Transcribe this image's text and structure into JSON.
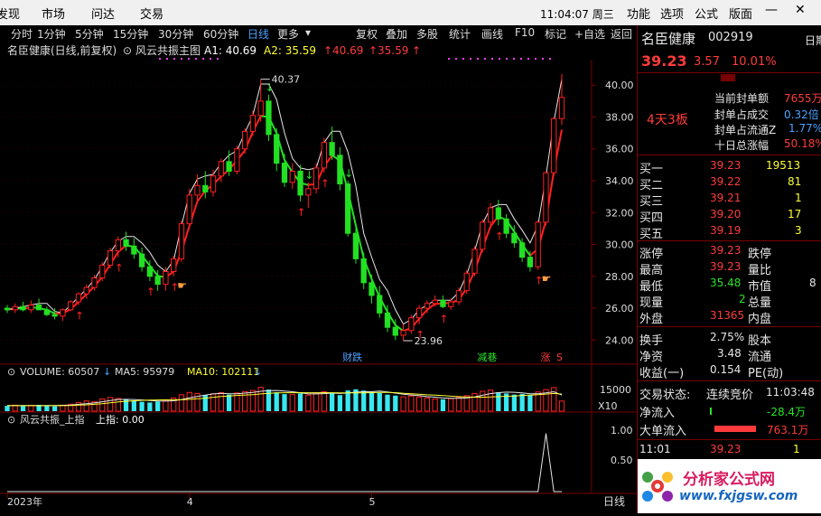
{
  "menu": {
    "items": [
      "发现",
      "市场",
      "问达",
      "交易"
    ],
    "time": "11:04:07 周三",
    "right_items": [
      "功能",
      "选项",
      "公式",
      "版面"
    ]
  },
  "toolbar": {
    "periods": [
      "分时",
      "1分钟",
      "5分钟",
      "15分钟",
      "30分钟",
      "60分钟",
      "日线",
      "更多"
    ],
    "active": "日线",
    "tools": [
      "复权",
      "叠加",
      "多股",
      "统计",
      "画线",
      "F10",
      "标记",
      "+自选",
      "返回"
    ]
  },
  "main_header": {
    "name": "名臣健康(日线,前复权)",
    "indicator": "风云共振主图",
    "a1_label": "A1: 40.69",
    "a2_label": "A2: 35.59",
    "v1": "40.69",
    "v2": "35.59"
  },
  "volume_header": {
    "vol": "VOLUME: 60507",
    "ma5": "MA5: 95979",
    "ma10": "MA10: 102111"
  },
  "sub_header": {
    "name": "风云共振_上指",
    "val": "上指: 0.00"
  },
  "chart_data": [
    {
      "type": "candlestick",
      "ylim": [
        22.6,
        41.6
      ],
      "y_ticks": [
        "40.00",
        "38.00",
        "36.00",
        "34.00",
        "32.00",
        "30.00",
        "28.00",
        "26.00",
        "24.00"
      ],
      "x_ticks": [
        {
          "label": "2023年",
          "index": 0
        },
        {
          "label": "4",
          "index": 23
        },
        {
          "label": "5",
          "index": 46
        }
      ],
      "annotations": [
        {
          "text": "40.37",
          "index": 32,
          "value": 40.37
        },
        {
          "text": "23.96",
          "index": 50,
          "value": 23.96
        },
        {
          "text": "财跌",
          "index": 43
        },
        {
          "text": "减巷",
          "index": 60
        },
        {
          "text": "涨",
          "index": 68
        },
        {
          "text": "S",
          "index": 70
        }
      ],
      "candles": [
        [
          26.0,
          26.2,
          25.7,
          25.9
        ],
        [
          25.9,
          26.3,
          25.7,
          26.1
        ],
        [
          26.1,
          26.4,
          25.8,
          25.9
        ],
        [
          25.9,
          26.5,
          25.7,
          26.2
        ],
        [
          26.2,
          26.6,
          25.9,
          25.9
        ],
        [
          25.9,
          26.1,
          25.5,
          25.6
        ],
        [
          25.6,
          26.0,
          25.3,
          25.5
        ],
        [
          25.5,
          26.0,
          25.2,
          25.9
        ],
        [
          25.9,
          26.5,
          25.8,
          26.4
        ],
        [
          26.4,
          27.0,
          26.2,
          26.9
        ],
        [
          26.9,
          27.5,
          26.6,
          27.3
        ],
        [
          27.3,
          28.1,
          27.1,
          27.9
        ],
        [
          27.9,
          28.9,
          27.7,
          28.7
        ],
        [
          28.7,
          29.8,
          28.5,
          29.6
        ],
        [
          29.6,
          30.5,
          29.2,
          30.3
        ],
        [
          30.3,
          30.8,
          29.6,
          29.9
        ],
        [
          29.9,
          30.4,
          29.1,
          29.4
        ],
        [
          29.4,
          29.8,
          28.3,
          28.6
        ],
        [
          28.6,
          29.0,
          27.7,
          28.0
        ],
        [
          28.0,
          28.4,
          27.1,
          27.5
        ],
        [
          27.5,
          28.6,
          27.1,
          28.3
        ],
        [
          28.3,
          29.3,
          28.0,
          29.1
        ],
        [
          29.1,
          31.5,
          28.9,
          31.3
        ],
        [
          31.3,
          33.5,
          31.0,
          33.1
        ],
        [
          33.1,
          34.4,
          32.6,
          33.7
        ],
        [
          33.7,
          34.6,
          32.9,
          33.3
        ],
        [
          33.3,
          34.7,
          33.0,
          34.3
        ],
        [
          34.3,
          35.4,
          33.9,
          35.2
        ],
        [
          35.2,
          35.9,
          34.3,
          34.6
        ],
        [
          34.6,
          36.2,
          34.4,
          36.0
        ],
        [
          36.0,
          37.3,
          35.7,
          37.1
        ],
        [
          37.1,
          38.4,
          36.8,
          38.1
        ],
        [
          38.1,
          40.37,
          37.7,
          39.0
        ],
        [
          39.0,
          39.4,
          36.5,
          36.9
        ],
        [
          36.9,
          37.3,
          34.6,
          35.1
        ],
        [
          35.1,
          35.7,
          33.6,
          33.9
        ],
        [
          33.9,
          35.1,
          33.5,
          34.6
        ],
        [
          34.6,
          35.0,
          32.7,
          33.1
        ],
        [
          33.1,
          33.9,
          32.3,
          33.5
        ],
        [
          33.5,
          35.1,
          33.2,
          34.8
        ],
        [
          34.8,
          36.7,
          34.5,
          36.4
        ],
        [
          36.4,
          37.4,
          35.3,
          35.6
        ],
        [
          35.6,
          36.1,
          33.4,
          33.8
        ],
        [
          33.8,
          34.0,
          30.5,
          30.7
        ],
        [
          30.7,
          31.0,
          28.8,
          29.1
        ],
        [
          29.1,
          29.5,
          27.2,
          27.6
        ],
        [
          27.6,
          28.1,
          26.3,
          26.8
        ],
        [
          26.8,
          27.4,
          25.4,
          25.7
        ],
        [
          25.7,
          26.2,
          24.5,
          24.8
        ],
        [
          24.8,
          25.3,
          24.0,
          24.3
        ],
        [
          24.3,
          25.0,
          23.96,
          24.6
        ],
        [
          24.6,
          25.6,
          24.4,
          25.4
        ],
        [
          25.4,
          26.2,
          25.0,
          26.0
        ],
        [
          26.0,
          26.5,
          25.7,
          26.3
        ],
        [
          26.3,
          26.8,
          26.1,
          26.5
        ],
        [
          26.5,
          26.8,
          26.0,
          26.1
        ],
        [
          26.1,
          26.6,
          25.9,
          26.4
        ],
        [
          26.4,
          27.3,
          26.2,
          27.1
        ],
        [
          27.1,
          28.4,
          26.9,
          28.2
        ],
        [
          28.2,
          29.9,
          28.0,
          29.7
        ],
        [
          29.7,
          31.6,
          29.5,
          31.4
        ],
        [
          31.4,
          32.6,
          31.0,
          32.3
        ],
        [
          32.3,
          32.8,
          31.2,
          31.6
        ],
        [
          31.6,
          31.9,
          30.4,
          30.7
        ],
        [
          30.7,
          31.2,
          29.8,
          30.1
        ],
        [
          30.1,
          30.4,
          28.9,
          29.2
        ],
        [
          29.2,
          29.6,
          28.3,
          28.6
        ],
        [
          28.6,
          31.5,
          28.4,
          31.4
        ],
        [
          31.4,
          34.6,
          31.2,
          34.5
        ],
        [
          34.5,
          38.0,
          34.3,
          37.9
        ],
        [
          37.9,
          40.69,
          37.5,
          39.23
        ]
      ]
    },
    {
      "type": "bar",
      "ylim": [
        0,
        20000
      ],
      "y_ticks": [
        "15000"
      ],
      "unit": "X10",
      "values": [
        3200,
        3600,
        3000,
        3400,
        3800,
        3100,
        2900,
        3600,
        4200,
        5200,
        6100,
        5600,
        7300,
        8200,
        7600,
        6900,
        6100,
        5600,
        5200,
        5800,
        6600,
        7900,
        9800,
        11200,
        10600,
        9700,
        10400,
        11100,
        9900,
        10900,
        11700,
        12400,
        14300,
        12900,
        11300,
        10200,
        9900,
        10600,
        9600,
        10900,
        11600,
        10900,
        9600,
        12400,
        13100,
        12300,
        11600,
        10900,
        9900,
        9300,
        8600,
        9100,
        8500,
        7900,
        7300,
        7100,
        7500,
        8200,
        9300,
        10600,
        11900,
        12600,
        11300,
        10600,
        9900,
        10300,
        9700,
        11500,
        12900,
        14100,
        6050
      ],
      "ma5": [
        3400,
        3400,
        3400,
        3400,
        3400,
        3400,
        3400,
        3500,
        3700,
        4100,
        4500,
        4900,
        5600,
        6400,
        7000,
        7100,
        7000,
        6700,
        6300,
        6100,
        6000,
        6200,
        7000,
        8000,
        8800,
        9600,
        10300,
        10700,
        10400,
        10400,
        10800,
        11200,
        11900,
        12300,
        12400,
        12000,
        11600,
        11000,
        10300,
        10300,
        10500,
        10800,
        10600,
        10900,
        11400,
        11600,
        11600,
        12000,
        11500,
        10800,
        10100,
        9700,
        9300,
        8700,
        8400,
        7900,
        7700,
        7700,
        7900,
        8500,
        9500,
        10500,
        11100,
        11400,
        11300,
        10900,
        10400,
        10400,
        10900,
        11600,
        9600
      ],
      "ma10": [
        3300,
        3300,
        3300,
        3300,
        3300,
        3300,
        3300,
        3300,
        3400,
        3600,
        3800,
        4100,
        4500,
        5000,
        5500,
        5900,
        6200,
        6500,
        6600,
        6700,
        6800,
        6800,
        6800,
        7100,
        7400,
        7800,
        8300,
        8800,
        9100,
        9400,
        9700,
        9900,
        10300,
        10700,
        10900,
        11000,
        11000,
        11100,
        11000,
        11000,
        11100,
        11000,
        10900,
        10900,
        10900,
        10900,
        11100,
        11200,
        11200,
        11100,
        10700,
        10400,
        10100,
        9800,
        9600,
        9300,
        9000,
        8700,
        8500,
        8400,
        8400,
        8500,
        8700,
        8900,
        9100,
        9400,
        9600,
        9900,
        10200,
        10600,
        10200
      ]
    },
    {
      "type": "line",
      "ylim": [
        0,
        1.15
      ],
      "y_ticks": [
        "1.00",
        "0.50"
      ],
      "values": [
        0,
        0,
        0,
        0,
        0,
        0,
        0,
        0,
        0,
        0,
        0,
        0,
        0,
        0,
        0,
        0,
        0,
        0,
        0,
        0,
        0,
        0,
        0,
        0,
        0,
        0,
        0,
        0,
        0,
        0,
        0,
        0,
        0,
        0,
        0,
        0,
        0,
        0,
        0,
        0,
        0,
        0,
        0,
        0,
        0,
        0,
        0,
        0,
        0,
        0,
        0,
        0,
        0,
        0,
        0,
        0,
        0,
        0,
        0,
        0,
        0,
        0,
        0,
        0,
        0,
        0,
        0,
        0,
        1,
        0,
        0
      ]
    }
  ],
  "right_panel": {
    "name": "名臣健康",
    "code": "002919",
    "price": "39.23",
    "change": "3.57",
    "pct": "10.01%",
    "tag": "日期",
    "board": "4天3板",
    "stats": [
      {
        "label": "当前封单额",
        "value": "7655万",
        "color": "red"
      },
      {
        "label": "封单占成交",
        "value": "0.32倍",
        "color": "cyan"
      },
      {
        "label": "封单占流通Z",
        "value": "1.77%",
        "color": "cyan"
      },
      {
        "label": "十日总涨幅",
        "value": "50.18%",
        "color": "red"
      }
    ],
    "bids": [
      {
        "label": "买一",
        "price": "39.23",
        "vol": "19513"
      },
      {
        "label": "买二",
        "price": "39.22",
        "vol": "81"
      },
      {
        "label": "买三",
        "price": "39.21",
        "vol": "1"
      },
      {
        "label": "买四",
        "price": "39.20",
        "vol": "17"
      },
      {
        "label": "买五",
        "price": "39.19",
        "vol": "3"
      }
    ],
    "quote_rows": [
      {
        "l1": "涨停",
        "v1": "39.23",
        "c1": "red",
        "l2": "跌停",
        "v2": ""
      },
      {
        "l1": "最高",
        "v1": "39.23",
        "c1": "red",
        "l2": "量比",
        "v2": ""
      },
      {
        "l1": "最低",
        "v1": "35.48",
        "c1": "green",
        "l2": "市值",
        "v2": "8"
      },
      {
        "l1": "现量",
        "v1": "2",
        "c1": "green",
        "l2": "总量",
        "v2": ""
      },
      {
        "l1": "外盘",
        "v1": "31365",
        "c1": "red",
        "l2": "内盘",
        "v2": ""
      }
    ],
    "stats2": [
      {
        "l1": "换手",
        "v1": "2.75%",
        "l2": "股本",
        "v2": ""
      },
      {
        "l1": "净资",
        "v1": "3.48",
        "l2": "流通",
        "v2": ""
      },
      {
        "l1": "收益(一)",
        "v1": "0.154",
        "l2": "PE(动)",
        "v2": ""
      }
    ],
    "status_label": "交易状态:",
    "status_value": "连续竞价",
    "status_time": "11:03:48",
    "net_inflow_label": "净流入",
    "net_inflow_value": "-28.4万",
    "big_inflow_label": "大单流入",
    "big_inflow_value": "763.1万",
    "trade_time": "11:01",
    "trade_price": "39.23",
    "trade_vol": "1",
    "bottom_tab": "日线"
  },
  "watermark": "分析家公式网",
  "watermark_url": "www.fxjgsw.com"
}
